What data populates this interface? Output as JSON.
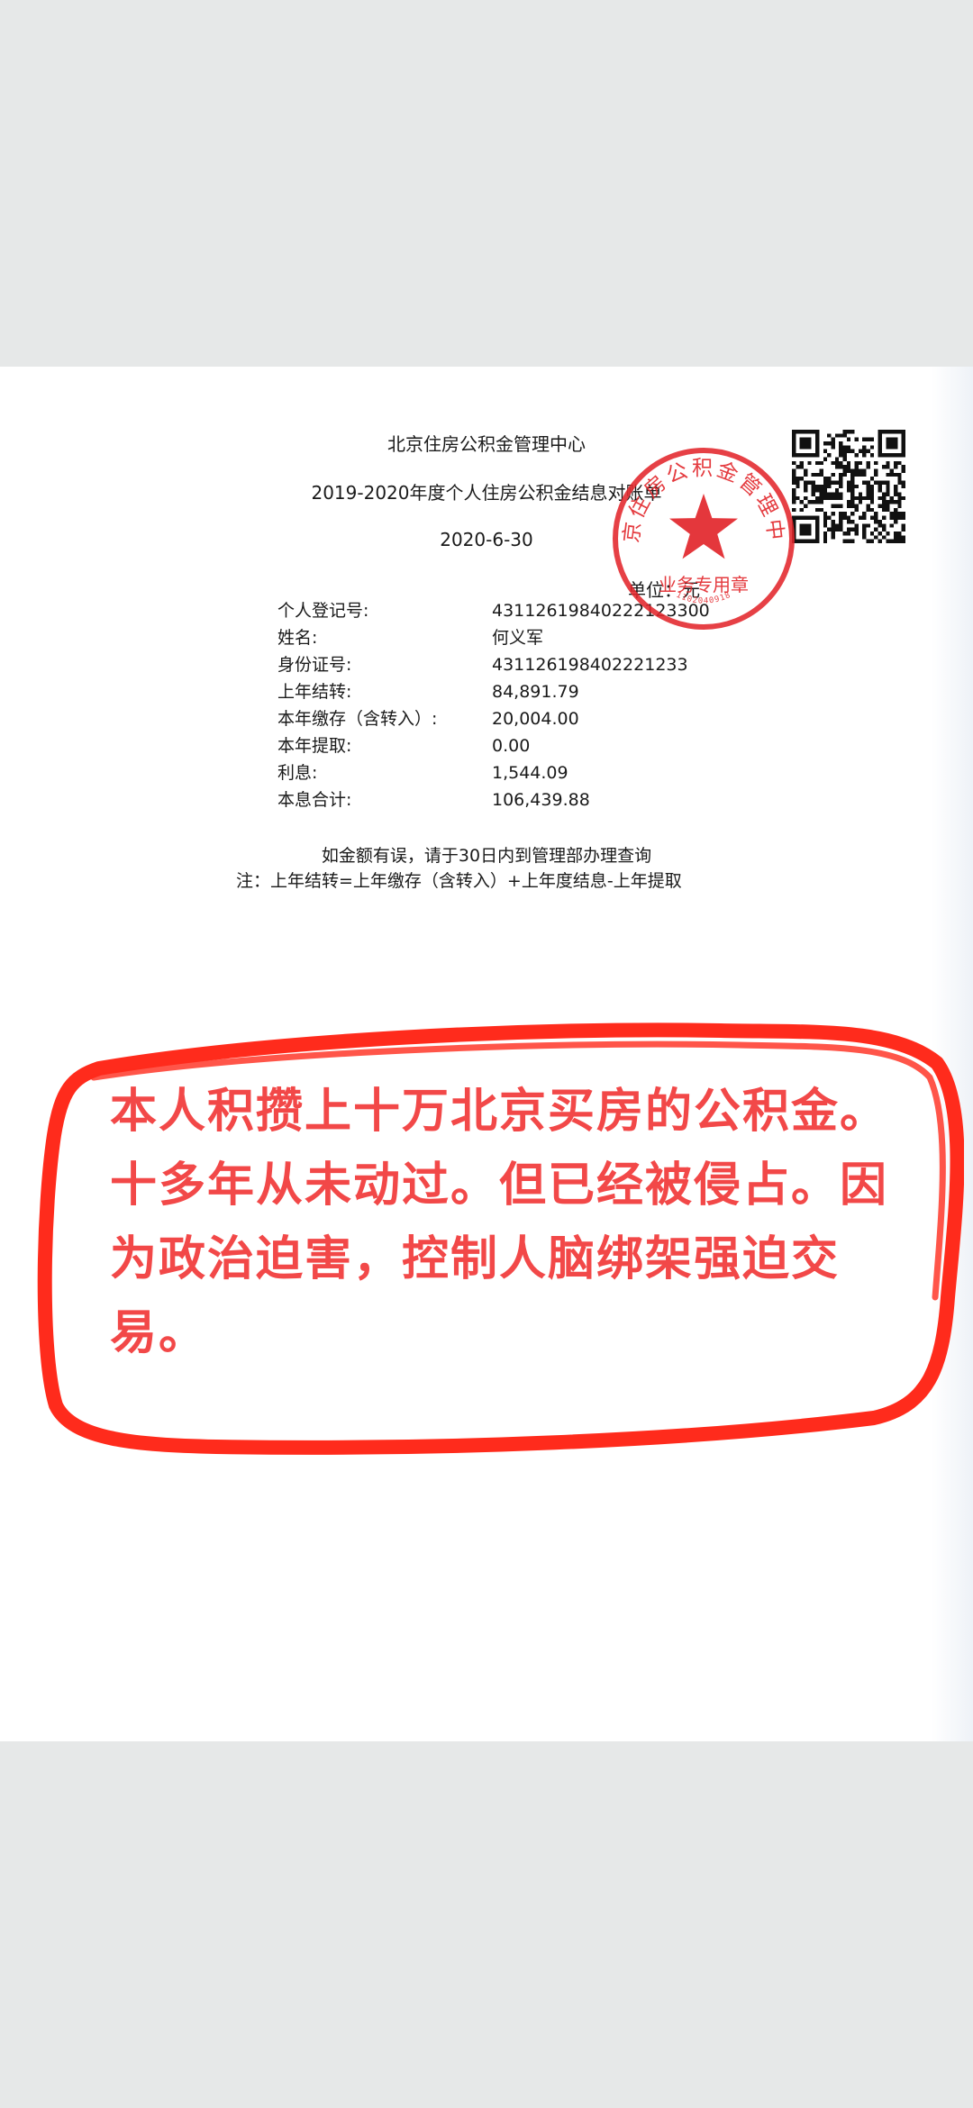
{
  "document": {
    "org_title": "北京住房公积金管理中心",
    "statement_title": "2019-2020年度个人住房公积金结息对账单",
    "date": "2020-6-30",
    "unit": "单位：元",
    "fields": [
      {
        "label": "个人登记号:",
        "value": "43112619840222123300"
      },
      {
        "label": "姓名:",
        "value": "何义军"
      },
      {
        "label": "身份证号:",
        "value": "431126198402221233"
      },
      {
        "label": "上年结转:",
        "value": "84,891.79"
      },
      {
        "label": "本年缴存（含转入）:",
        "value": "20,004.00"
      },
      {
        "label": "本年提取:",
        "value": "0.00"
      },
      {
        "label": "利息:",
        "value": "1,544.09"
      },
      {
        "label": "本息合计:",
        "value": "106,439.88"
      }
    ],
    "note_line1": "如金额有误，请于30日内到管理部办理查询",
    "note_line2": "注：上年结转=上年缴存（含转入）+上年度结息-上年提取",
    "seal_text": "北京住房公积金管理中心",
    "seal_subtext": "业务专用章",
    "seal_number": "1102040918"
  },
  "annotation": {
    "text": "本人积攒上十万北京买房的公积金。十多年从未动过。但已经被侵占。因为政治迫害，控制人脑绑架强迫交易。",
    "color": "#f24848",
    "outline_color": "#ff2b1c"
  },
  "colors": {
    "background": "#e6e8e8",
    "paper": "#ffffff",
    "seal": "#e2262b"
  }
}
